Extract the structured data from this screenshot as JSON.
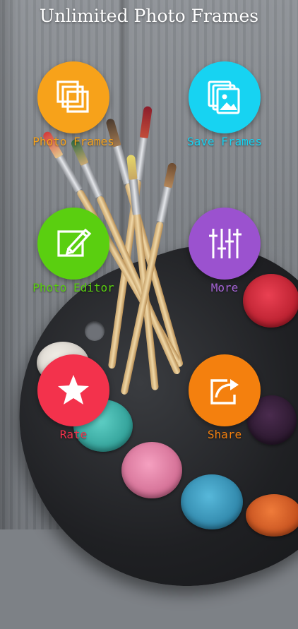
{
  "app": {
    "title": "Unlimited Photo Frames"
  },
  "menu": {
    "items": [
      {
        "label": "Photo Frames",
        "icon": "stacked-frames-icon",
        "color": "#F7A21A",
        "label_color": "#F7A21A"
      },
      {
        "label": "Save Frames",
        "icon": "photo-stack-icon",
        "color": "#17D3F2",
        "label_color": "#17D3F2"
      },
      {
        "label": "Photo Editor",
        "icon": "edit-pencil-icon",
        "color": "#5ACF10",
        "label_color": "#5ACF10"
      },
      {
        "label": "More",
        "icon": "sliders-icon",
        "color": "#9B52CF",
        "label_color": "#A664D6"
      },
      {
        "label": "Rate",
        "icon": "star-icon",
        "color": "#F3324C",
        "label_color": "#F3324C"
      },
      {
        "label": "Share",
        "icon": "share-arrow-icon",
        "color": "#F4800E",
        "label_color": "#F4800E"
      }
    ]
  }
}
